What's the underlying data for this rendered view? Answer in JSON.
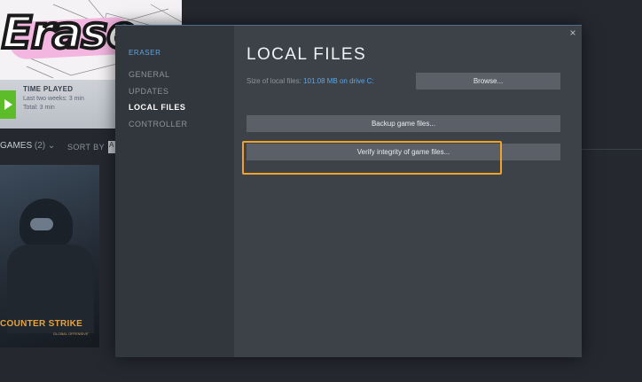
{
  "background": {
    "hero_logo": "Erase",
    "time_played": {
      "title": "TIME PLAYED",
      "last_two_weeks": "Last two weeks: 3 min",
      "total": "Total: 3 min"
    },
    "games_label": "GAMES",
    "games_count": "(2)",
    "sort_by": "SORT BY",
    "sort_value": "A",
    "card_logo": "COUNTER STRIKE",
    "card_sub": "GLOBAL OFFENSIVE"
  },
  "dialog": {
    "game_name": "ERASER",
    "close_glyph": "×",
    "nav": [
      {
        "label": "GENERAL",
        "active": false
      },
      {
        "label": "UPDATES",
        "active": false
      },
      {
        "label": "LOCAL FILES",
        "active": true
      },
      {
        "label": "CONTROLLER",
        "active": false
      }
    ],
    "title": "LOCAL FILES",
    "size_label": "Size of local files:",
    "size_value": "101.08 MB on drive C:",
    "browse_label": "Browse...",
    "backup_label": "Backup game files...",
    "verify_label": "Verify integrity of game files..."
  },
  "colors": {
    "accent": "#5fa5e3",
    "highlight": "#f2a229"
  }
}
